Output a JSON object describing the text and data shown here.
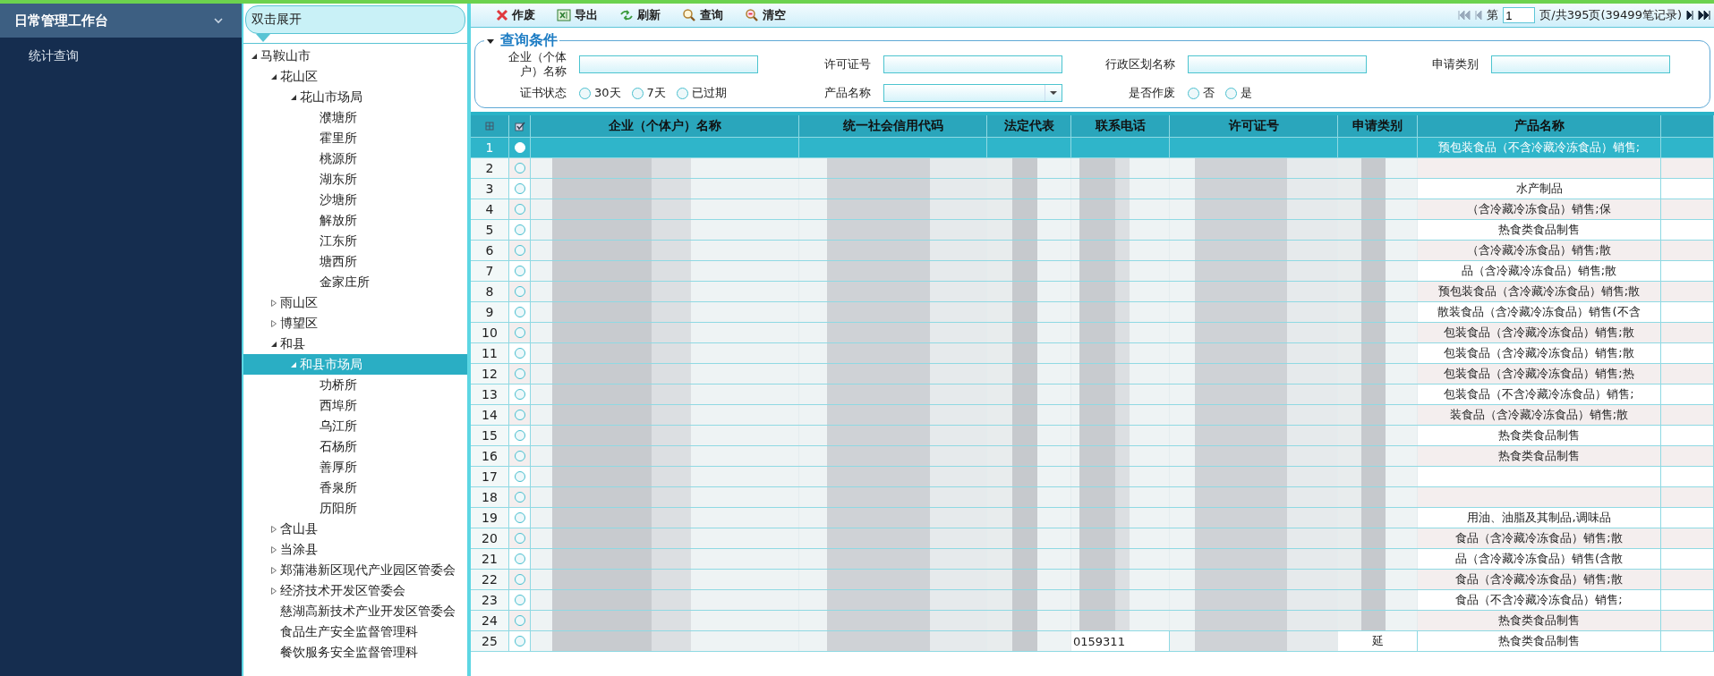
{
  "sidebar": {
    "title": "日常管理工作台",
    "expanded": true,
    "items": [
      {
        "label": "统计查询",
        "selected": false
      }
    ]
  },
  "tree": {
    "hint": "双击展开",
    "nodes": [
      {
        "label": "马鞍山市",
        "expanded": true,
        "selected": false,
        "children": [
          {
            "label": "花山区",
            "expanded": true,
            "selected": false,
            "children": [
              {
                "label": "花山市场局",
                "expanded": true,
                "selected": false,
                "children": [
                  {
                    "label": "濮塘所",
                    "selected": false
                  },
                  {
                    "label": "霍里所",
                    "selected": false
                  },
                  {
                    "label": "桃源所",
                    "selected": false
                  },
                  {
                    "label": "湖东所",
                    "selected": false
                  },
                  {
                    "label": "沙塘所",
                    "selected": false
                  },
                  {
                    "label": "解放所",
                    "selected": false
                  },
                  {
                    "label": "江东所",
                    "selected": false
                  },
                  {
                    "label": "塘西所",
                    "selected": false
                  },
                  {
                    "label": "金家庄所",
                    "selected": false
                  }
                ]
              }
            ]
          },
          {
            "label": "雨山区",
            "expanded": false,
            "selected": false
          },
          {
            "label": "博望区",
            "expanded": false,
            "selected": false
          },
          {
            "label": "和县",
            "expanded": true,
            "selected": false,
            "children": [
              {
                "label": "和县市场局",
                "expanded": true,
                "selected": true,
                "children": [
                  {
                    "label": "功桥所",
                    "selected": false
                  },
                  {
                    "label": "西埠所",
                    "selected": false
                  },
                  {
                    "label": "乌江所",
                    "selected": false
                  },
                  {
                    "label": "石杨所",
                    "selected": false
                  },
                  {
                    "label": "善厚所",
                    "selected": false
                  },
                  {
                    "label": "香泉所",
                    "selected": false
                  },
                  {
                    "label": "历阳所",
                    "selected": false
                  }
                ]
              }
            ]
          },
          {
            "label": "含山县",
            "expanded": false,
            "selected": false
          },
          {
            "label": "当涂县",
            "expanded": false,
            "selected": false
          },
          {
            "label": "郑蒲港新区现代产业园区管委会",
            "expanded": false,
            "selected": false
          },
          {
            "label": "经济技术开发区管委会",
            "expanded": false,
            "selected": false
          },
          {
            "label": "慈湖高新技术产业开发区管委会",
            "selected": false
          },
          {
            "label": "食品生产安全监督管理科",
            "selected": false
          },
          {
            "label": "餐饮服务安全监督管理科",
            "selected": false
          }
        ]
      }
    ]
  },
  "toolbar": {
    "buttons": [
      {
        "kind": "void",
        "label": "作废"
      },
      {
        "kind": "export",
        "label": "导出"
      },
      {
        "kind": "refresh",
        "label": "刷新"
      },
      {
        "kind": "search",
        "label": "查询"
      },
      {
        "kind": "clear",
        "label": "清空"
      }
    ]
  },
  "pager": {
    "prefix": "第",
    "page": "1",
    "suffix": "页/共395页(39499笔记录)"
  },
  "query": {
    "legend": "查询条件",
    "expanded": true,
    "fields": [
      {
        "kind": "text",
        "label": "企业（个体户）名称"
      },
      {
        "kind": "text",
        "label": "许可证号"
      },
      {
        "kind": "text",
        "label": "行政区划名称"
      },
      {
        "kind": "text",
        "label": "申请类别"
      },
      {
        "kind": "radio",
        "label": "证书状态",
        "options": [
          {
            "label": "30天",
            "selected": false
          },
          {
            "label": "7天",
            "selected": false
          },
          {
            "label": "已过期",
            "selected": false
          }
        ]
      },
      {
        "kind": "select",
        "label": "产品名称"
      },
      {
        "kind": "radio",
        "label": "是否作废",
        "options": [
          {
            "label": "否",
            "selected": false
          },
          {
            "label": "是",
            "selected": false
          }
        ]
      }
    ]
  },
  "table": {
    "columns": [
      "企业（个体户）名称",
      "统一社会信用代码",
      "法定代表",
      "联系电话",
      "许可证号",
      "申请类别",
      "产品名称"
    ],
    "rows": [
      {
        "number": "1",
        "selected": true,
        "product": "预包装食品（不含冷藏冷冻食品）销售;"
      },
      {
        "number": "2",
        "selected": false
      },
      {
        "number": "3",
        "selected": false,
        "product": "水产制品"
      },
      {
        "number": "4",
        "selected": false,
        "product": "（含冷藏冷冻食品）销售;保"
      },
      {
        "number": "5",
        "selected": false,
        "product": "热食类食品制售"
      },
      {
        "number": "6",
        "selected": false,
        "product": "（含冷藏冷冻食品）销售;散"
      },
      {
        "number": "7",
        "selected": false,
        "product": "品（含冷藏冷冻食品）销售;散"
      },
      {
        "number": "8",
        "selected": false,
        "product": "预包装食品（含冷藏冷冻食品）销售;散"
      },
      {
        "number": "9",
        "selected": false,
        "product": "散装食品（含冷藏冷冻食品）销售(不含"
      },
      {
        "number": "10",
        "selected": false,
        "product": "包装食品（含冷藏冷冻食品）销售;散"
      },
      {
        "number": "11",
        "selected": false,
        "product": "包装食品（含冷藏冷冻食品）销售;散"
      },
      {
        "number": "12",
        "selected": false,
        "product": "包装食品（含冷藏冷冻食品）销售;热"
      },
      {
        "number": "13",
        "selected": false,
        "product": "包装食品（不含冷藏冷冻食品）销售;"
      },
      {
        "number": "14",
        "selected": false,
        "product": "装食品（含冷藏冷冻食品）销售;散"
      },
      {
        "number": "15",
        "selected": false,
        "product": "热食类食品制售"
      },
      {
        "number": "16",
        "selected": false,
        "product": "热食类食品制售"
      },
      {
        "number": "17",
        "selected": false
      },
      {
        "number": "18",
        "selected": false
      },
      {
        "number": "19",
        "selected": false,
        "product": "用油、油脂及其制品,调味品"
      },
      {
        "number": "20",
        "selected": false,
        "product": "食品（含冷藏冷冻食品）销售;散"
      },
      {
        "number": "21",
        "selected": false,
        "product": "品（含冷藏冷冻食品）销售(含散"
      },
      {
        "number": "22",
        "selected": false,
        "product": "食品（含冷藏冷冻食品）销售;散"
      },
      {
        "number": "23",
        "selected": false,
        "product": "食品（不含冷藏冷冻食品）销售;"
      },
      {
        "number": "24",
        "selected": false,
        "product": "热食类食品制售"
      },
      {
        "number": "25",
        "selected": false,
        "phone": "0159311",
        "category": "延",
        "product": "热食类食品制售"
      }
    ]
  }
}
